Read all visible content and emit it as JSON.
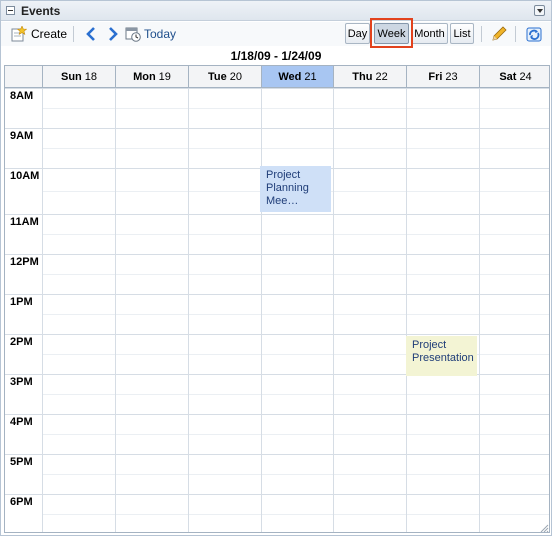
{
  "panel": {
    "title": "Events"
  },
  "toolbar": {
    "create_label": "Create",
    "today_label": "Today",
    "views": [
      "Day",
      "Week",
      "Month",
      "List"
    ],
    "active_view": "Week"
  },
  "calendar": {
    "date_range": "1/18/09 - 1/24/09",
    "days": [
      {
        "name": "Sun",
        "num": "18"
      },
      {
        "name": "Mon",
        "num": "19"
      },
      {
        "name": "Tue",
        "num": "20"
      },
      {
        "name": "Wed",
        "num": "21"
      },
      {
        "name": "Thu",
        "num": "22"
      },
      {
        "name": "Fri",
        "num": "23"
      },
      {
        "name": "Sat",
        "num": "24"
      }
    ],
    "today_index": 3,
    "hours": [
      "8AM",
      "9AM",
      "10AM",
      "11AM",
      "12PM",
      "1PM",
      "2PM",
      "3PM",
      "4PM",
      "5PM",
      "6PM"
    ],
    "events": [
      {
        "title_lines": [
          "Project",
          "Planning",
          "Mee…"
        ]
      },
      {
        "title_lines": [
          "Project",
          "Presentation"
        ]
      }
    ]
  },
  "colors": {
    "today_header": "#a8c6f2",
    "event_meeting": "#cfe0f7",
    "event_presentation": "#f3f4d4",
    "highlight_box": "#e2421d"
  }
}
